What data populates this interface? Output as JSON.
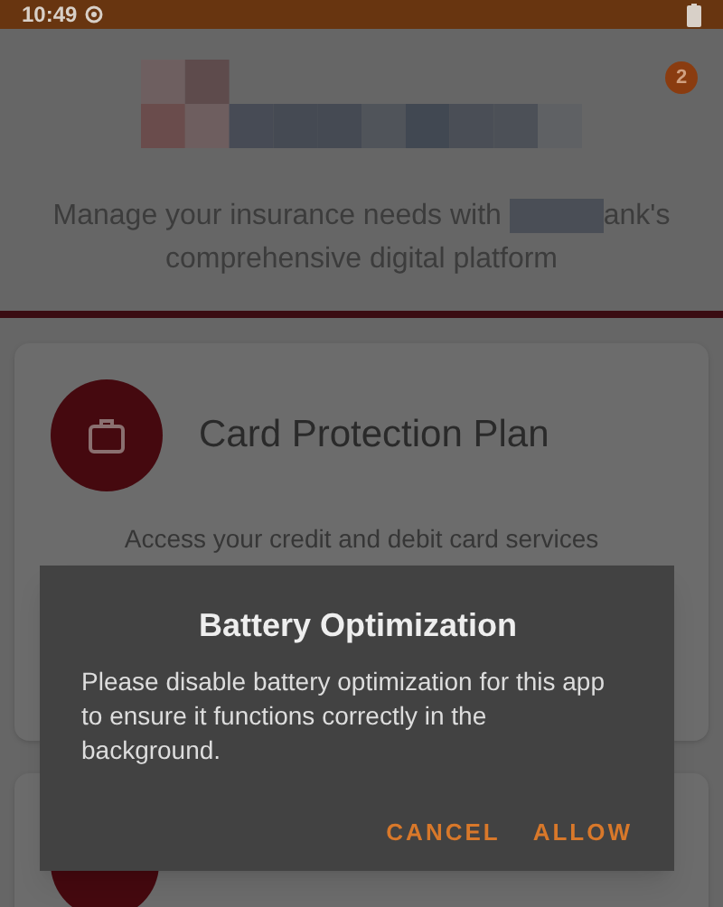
{
  "status_bar": {
    "time": "10:49"
  },
  "header": {
    "notification_count": "2",
    "tagline_before": "Manage your insurance needs with",
    "tagline_after": "ank's",
    "tagline_line2": "comprehensive digital platform"
  },
  "cards": [
    {
      "title": "Card Protection Plan",
      "description": "Access your credit and debit card services"
    },
    {
      "kind": "hidden"
    }
  ],
  "dialog": {
    "title": "Battery Optimization",
    "message": "Please disable battery optimization for this app to ensure it functions correctly in the background.",
    "buttons": [
      "CANCEL",
      "ALLOW"
    ]
  }
}
